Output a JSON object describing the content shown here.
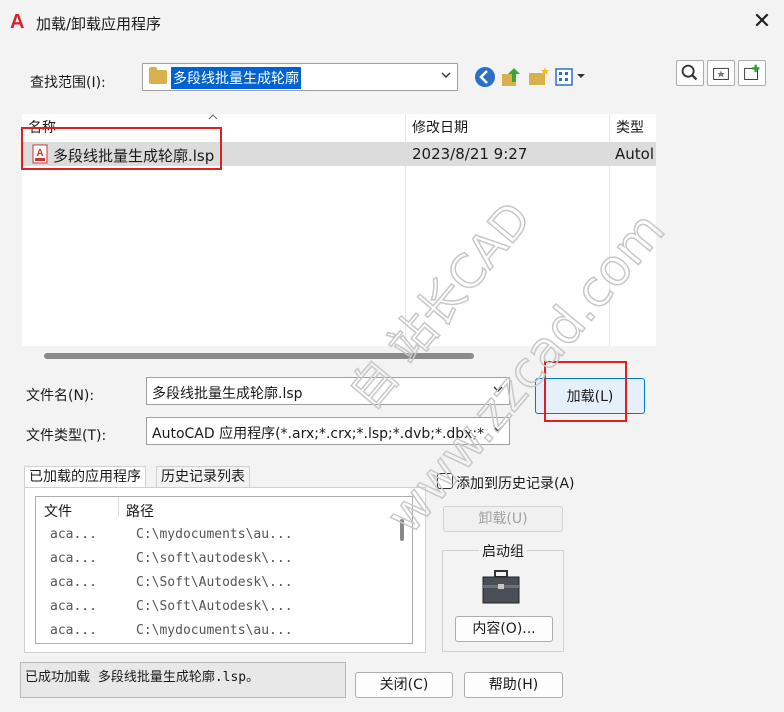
{
  "window": {
    "title": "加载/卸载应用程序",
    "app_icon_glyph": "A",
    "close_glyph": "✕"
  },
  "look_in": {
    "label": "查找范围(I):",
    "value": "多段线批量生成轮廓"
  },
  "file_list": {
    "columns": [
      "名称",
      "修改日期",
      "类型"
    ],
    "rows": [
      {
        "name": "多段线批量生成轮廓.lsp",
        "modified": "2023/8/21 9:27",
        "type": "Autol"
      }
    ]
  },
  "file_name": {
    "label": "文件名(N):",
    "value": "多段线批量生成轮廓.lsp"
  },
  "file_type": {
    "label": "文件类型(T):",
    "value": "AutoCAD 应用程序(*.arx;*.crx;*.lsp;*.dvb;*.dbx;*"
  },
  "load_button": "加载(L)",
  "tabs": [
    "已加载的应用程序",
    "历史记录列表"
  ],
  "loaded_apps": {
    "columns": [
      "文件",
      "路径"
    ],
    "rows": [
      {
        "file": "aca...",
        "path": "C:\\mydocuments\\au..."
      },
      {
        "file": "aca...",
        "path": "C:\\soft\\autodesk\\..."
      },
      {
        "file": "aca...",
        "path": "C:\\Soft\\Autodesk\\..."
      },
      {
        "file": "aca...",
        "path": "C:\\Soft\\Autodesk\\..."
      },
      {
        "file": "aca...",
        "path": "C:\\mydocuments\\au..."
      }
    ]
  },
  "add_to_history": {
    "label": "添加到历史记录(A)",
    "checked": false
  },
  "unload_button": "卸载(U)",
  "startup_group": {
    "title": "启动组",
    "contents_button": "内容(O)..."
  },
  "status": "已成功加载 多段线批量生成轮廓.lsp。",
  "close_button": "关闭(C)",
  "help_button": "帮助(H)",
  "watermark": {
    "line1": "自 站长CAD",
    "line2": "www.zzcad.com"
  },
  "colors": {
    "accent": "#0078d4",
    "selection": "#0063d1",
    "highlight_box": "#e02020",
    "app_red": "#d2232a"
  }
}
